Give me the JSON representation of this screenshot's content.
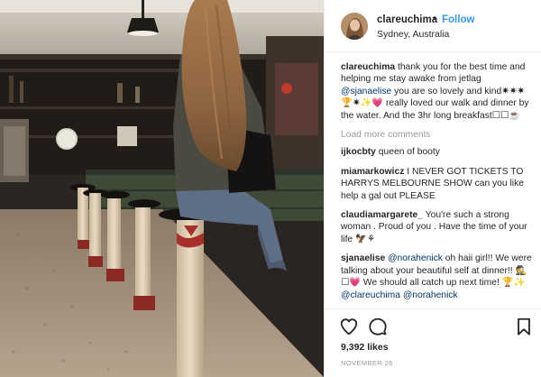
{
  "header": {
    "username": "clareuchima",
    "separator": "•",
    "follow_label": "Follow",
    "location": "Sydney, Australia"
  },
  "caption": {
    "user": "clareuchima",
    "part1": " thank you for the best time and helping me stay awake from jetlag ",
    "mention": "@sjanaelise",
    "part2": " you are so lovely and kind✷✷✷🏆✷✨💗 really loved our walk and dinner by the water. And the 3hr long breakfast☐☐☕"
  },
  "load_more_label": "Load more comments",
  "comments": [
    {
      "user": "ijkocbty",
      "text": " queen of booty"
    },
    {
      "user": "miamarkowicz",
      "text": " I NEVER GOT TICKETS TO HARRYS MELBOURNE SHOW can you like help a gal out PLEASE"
    },
    {
      "user": "claudiamargarete_",
      "text": " You're such a strong woman . Proud of you . Have the time of your life 🦅⚘"
    },
    {
      "user": "sjanaelise",
      "mention1": "@norahenick",
      "text1": " oh haii girl!! We were talking about your beautiful self at dinner!! 🕵☐💗 We should all catch up next time! 🏆✨ ",
      "mention2": "@clareuchima",
      "mention3": "@norahenick"
    }
  ],
  "icons": {
    "like": "heart-outline-icon",
    "comment": "speech-bubble-icon",
    "save": "bookmark-icon"
  },
  "likes_label": "9,392 likes",
  "date_label": "NOVEMBER 26",
  "colors": {
    "link_blue": "#3897f0",
    "mention_navy": "#003569",
    "muted_gray": "#999999",
    "text_dark": "#262626",
    "divider": "#efefef"
  }
}
